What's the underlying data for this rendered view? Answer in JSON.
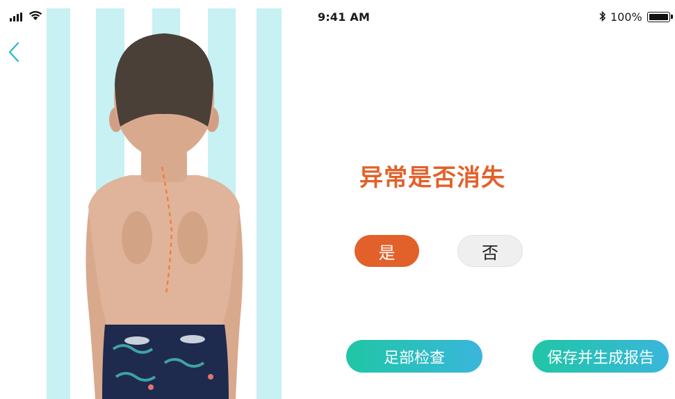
{
  "status_bar": {
    "time": "9:41 AM",
    "battery_percent": "100%",
    "battery_level": 1.0,
    "icons": [
      "signal-icon",
      "wifi-icon",
      "bluetooth-icon",
      "battery-icon"
    ]
  },
  "navigation": {
    "back_icon": "chevron-left-icon"
  },
  "photo": {
    "subject": "child back posture photo",
    "spine_line_color": "#f0803e"
  },
  "question": {
    "title": "异常是否消失"
  },
  "options": {
    "yes_label": "是",
    "no_label": "否",
    "selected": "yes"
  },
  "actions": {
    "foot_check_label": "足部检查",
    "save_report_label": "保存并生成报告"
  },
  "colors": {
    "accent": "#e2612a",
    "gradient_start": "#20c6a5",
    "gradient_end": "#3ab6dc",
    "background_stripe": "#c7f1f2"
  }
}
